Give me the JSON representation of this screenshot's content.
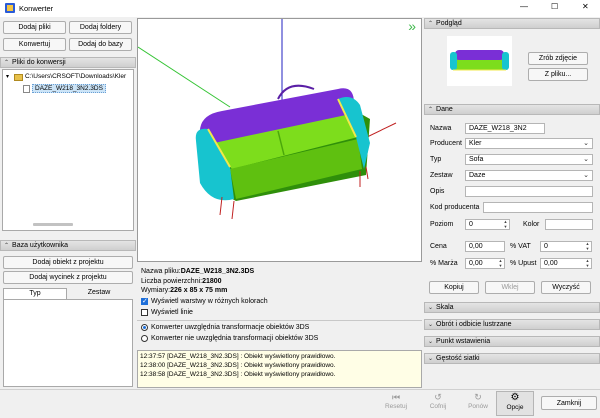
{
  "window": {
    "title": "Konwerter",
    "minimize_glyph": "—",
    "maximize_glyph": "☐",
    "close_glyph": "✕"
  },
  "left": {
    "buttons": {
      "add_files": "Dodaj pliki",
      "add_folders": "Dodaj foldery",
      "convert": "Konwertuj",
      "add_to_db": "Dodaj do bazy"
    },
    "files_header": "Pliki do konwersji",
    "tree": {
      "folder": "C:\\Users\\CRSOFT\\Downloads\\Kler",
      "file": "DAZE_W218_3N2.3DS"
    },
    "user_db_header": "Baza użytkownika",
    "add_object_btn": "Dodaj obiekt z projektu",
    "add_cut_btn": "Dodaj wycinek z projektu",
    "tabs": [
      "Typ",
      "Zestaw"
    ]
  },
  "viewport": {
    "expand_glyph": "»"
  },
  "info": {
    "file_name_label": "Nazwa pliku:",
    "file_name": "DAZE_W218_3N2.3DS",
    "surfaces_label": "Liczba powierzchni:",
    "surfaces": "21800",
    "dims_label": "Wymiary:",
    "dims": "226 x 85 x 75 mm",
    "show_layers": "Wyświetl warstwy w różnych kolorach",
    "show_lines": "Wyświetl linie",
    "radio_yes": "Konwerter uwzględnia transformacje obiektów 3DS",
    "radio_no": "Konwerter nie uwzględnia transformacji obiektów 3DS"
  },
  "log": [
    "12:37:57 [DAZE_W218_3N2.3DS] : Obiekt wyświetlony prawidłowo.",
    "12:38:00 [DAZE_W218_3N2.3DS] : Obiekt wyświetlony prawidłowo.",
    "12:38:58 [DAZE_W218_3N2.3DS] : Obiekt wyświetlony prawidłowo."
  ],
  "right": {
    "preview_header": "Podgląd",
    "take_photo": "Zrób zdjęcie",
    "from_file": "Z pliku...",
    "data_header": "Dane",
    "fields": {
      "name_label": "Nazwa",
      "name": "DAZE_W218_3N2",
      "producer_label": "Producent",
      "producer": "Kler",
      "type_label": "Typ",
      "type": "Sofa",
      "set_label": "Zestaw",
      "set": "Daze",
      "desc_label": "Opis",
      "producer_code_label": "Kod producenta",
      "level_label": "Poziom",
      "level": "0",
      "color_label": "Kolor",
      "price_label": "Cena",
      "price": "0,00",
      "vat_label": "% VAT",
      "vat": "0",
      "margin_label": "% Marża",
      "margin": "0,00",
      "discount_label": "% Upust",
      "discount": "0,00"
    },
    "copy": "Kopiuj",
    "paste": "Wklej",
    "clear": "Wyczyść",
    "sections": [
      "Skala",
      "Obrót i odbicie lustrzane",
      "Punkt wstawienia",
      "Gęstość siatki"
    ]
  },
  "bottom": {
    "reset": "Resetuj",
    "undo": "Cofnij",
    "redo": "Ponów",
    "options": "Opcje",
    "close": "Zamknij"
  },
  "colors": {
    "sofa_purple": "#7a2fd6",
    "sofa_green": "#7ddd1c",
    "sofa_cyan": "#17c4cf",
    "sofa_yellow": "#f2e84a",
    "log_bg": "#fffee6",
    "axis_green": "#35c435",
    "axis_blue": "#2020c0",
    "axis_red": "#c02020"
  },
  "icons": [
    "app-icon",
    "folder-icon",
    "file-icon",
    "reset-icon",
    "undo-icon",
    "redo-icon",
    "gear-icon",
    "chevron-down-icon",
    "chevron-up-icon"
  ]
}
